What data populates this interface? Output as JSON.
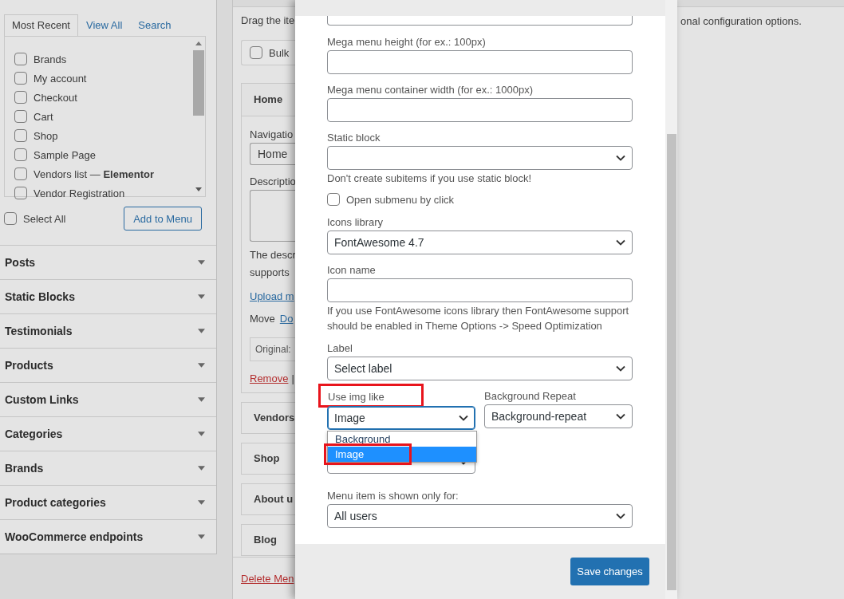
{
  "left_panel": {
    "tabs": [
      {
        "label": "Most Recent",
        "selected": true
      },
      {
        "label": "View All",
        "selected": false
      },
      {
        "label": "Search",
        "selected": false
      }
    ],
    "items": [
      {
        "label": "Brands",
        "checked": false
      },
      {
        "label": "My account",
        "checked": false
      },
      {
        "label": "Checkout",
        "checked": false
      },
      {
        "label": "Cart",
        "checked": false
      },
      {
        "label": "Shop",
        "checked": false
      },
      {
        "label": "Sample Page",
        "checked": false
      },
      {
        "label": "Vendors list — **Elementor**",
        "checked": false
      },
      {
        "label": "Vendor Registration",
        "checked": false
      }
    ],
    "select_all": {
      "label": "Select All",
      "checked": false
    },
    "add_button": "Add to Menu",
    "sections": [
      "Posts",
      "Static Blocks",
      "Testimonials",
      "Products",
      "Custom Links",
      "Categories",
      "Brands",
      "Product categories",
      "WooCommerce endpoints"
    ]
  },
  "menu_structure": {
    "intro": "Drag the ite",
    "bulk_select": {
      "label": "Bulk",
      "checked": false
    },
    "open_item": {
      "title": "Home",
      "nav_label": "Navigatio",
      "nav_value": "Home",
      "desc_label": "Descriptio",
      "desc_lines": [
        "The descr",
        "supports"
      ],
      "upload_link": "Upload m",
      "move_label": "Move",
      "move_link": "Do",
      "original": "Original:",
      "remove_link": "Remove",
      "separator": "|"
    },
    "items": [
      "Vendors",
      "Shop",
      "About u",
      "Blog"
    ],
    "delete_link": "Delete Men"
  },
  "right_note": "onal configuration options.",
  "modal": {
    "fields": [
      {
        "kind": "cut-select"
      },
      {
        "kind": "input",
        "label": "Mega menu height (for ex.: 100px)"
      },
      {
        "kind": "input",
        "label": "Mega menu container width (for ex.: 1000px)"
      },
      {
        "kind": "select",
        "label": "Static block"
      },
      {
        "kind": "hint",
        "text": "Don't create subitems if you use static block!"
      },
      {
        "kind": "checkbox",
        "label": "Open submenu by click",
        "checked": false
      },
      {
        "kind": "select",
        "label": "Icons library",
        "value": "FontAwesome 4.7"
      },
      {
        "kind": "input",
        "label": "Icon name"
      },
      {
        "kind": "hint",
        "text": "If you use FontAwesome icons library then FontAwesome support should be enabled in Theme Options -> Speed Optimization"
      },
      {
        "kind": "select",
        "label": "Label",
        "value": "Select label"
      }
    ],
    "image_row": {
      "left": {
        "label": "Use img like",
        "highlighted": true,
        "value": "Image",
        "open": true,
        "options": [
          {
            "label": "Background",
            "selected": false,
            "highlighted": false
          },
          {
            "label": "Image",
            "selected": true,
            "highlighted": true
          }
        ]
      },
      "right": {
        "label": "Background Repeat",
        "value": "Background-repeat"
      }
    },
    "shown_for": {
      "label": "Menu item is shown only for:",
      "value": "All users"
    },
    "save_button": "Save changes"
  }
}
